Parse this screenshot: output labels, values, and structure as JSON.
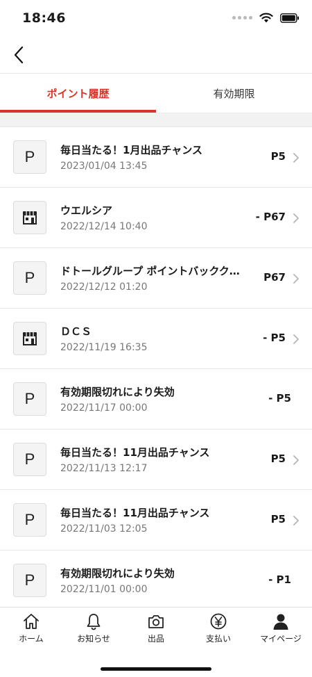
{
  "status_bar": {
    "time": "18:46"
  },
  "tabs": [
    {
      "label": "ポイント履歴",
      "active": true
    },
    {
      "label": "有効期限",
      "active": false
    }
  ],
  "history": [
    {
      "icon": "p",
      "title": "毎日当たる！1月出品チャンス",
      "date": "2023/01/04 13:45",
      "amount": "P5",
      "chevron": true
    },
    {
      "icon": "store",
      "title": "ウエルシア",
      "date": "2022/12/14 10:40",
      "amount": "- P67",
      "chevron": true
    },
    {
      "icon": "p",
      "title": "ドトールグループ ポイントバックク…",
      "date": "2022/12/12 01:20",
      "amount": "P67",
      "chevron": true
    },
    {
      "icon": "store",
      "title": "ＤＣＳ",
      "date": "2022/11/19 16:35",
      "amount": "- P5",
      "chevron": true
    },
    {
      "icon": "p",
      "title": "有効期限切れにより失効",
      "date": "2022/11/17 00:00",
      "amount": "- P5",
      "chevron": false
    },
    {
      "icon": "p",
      "title": "毎日当たる！11月出品チャンス",
      "date": "2022/11/13 12:17",
      "amount": "P5",
      "chevron": true
    },
    {
      "icon": "p",
      "title": "毎日当たる！11月出品チャンス",
      "date": "2022/11/03 12:05",
      "amount": "P5",
      "chevron": true
    },
    {
      "icon": "p",
      "title": "有効期限切れにより失効",
      "date": "2022/11/01 00:00",
      "amount": "- P1",
      "chevron": false
    }
  ],
  "p_icon_letter": "P",
  "bottom_nav": [
    {
      "label": "ホーム",
      "icon": "home-icon"
    },
    {
      "label": "お知らせ",
      "icon": "bell-icon"
    },
    {
      "label": "出品",
      "icon": "camera-icon"
    },
    {
      "label": "支払い",
      "icon": "yen-icon"
    },
    {
      "label": "マイページ",
      "icon": "person-icon"
    }
  ],
  "colors": {
    "accent": "#d8362b"
  }
}
